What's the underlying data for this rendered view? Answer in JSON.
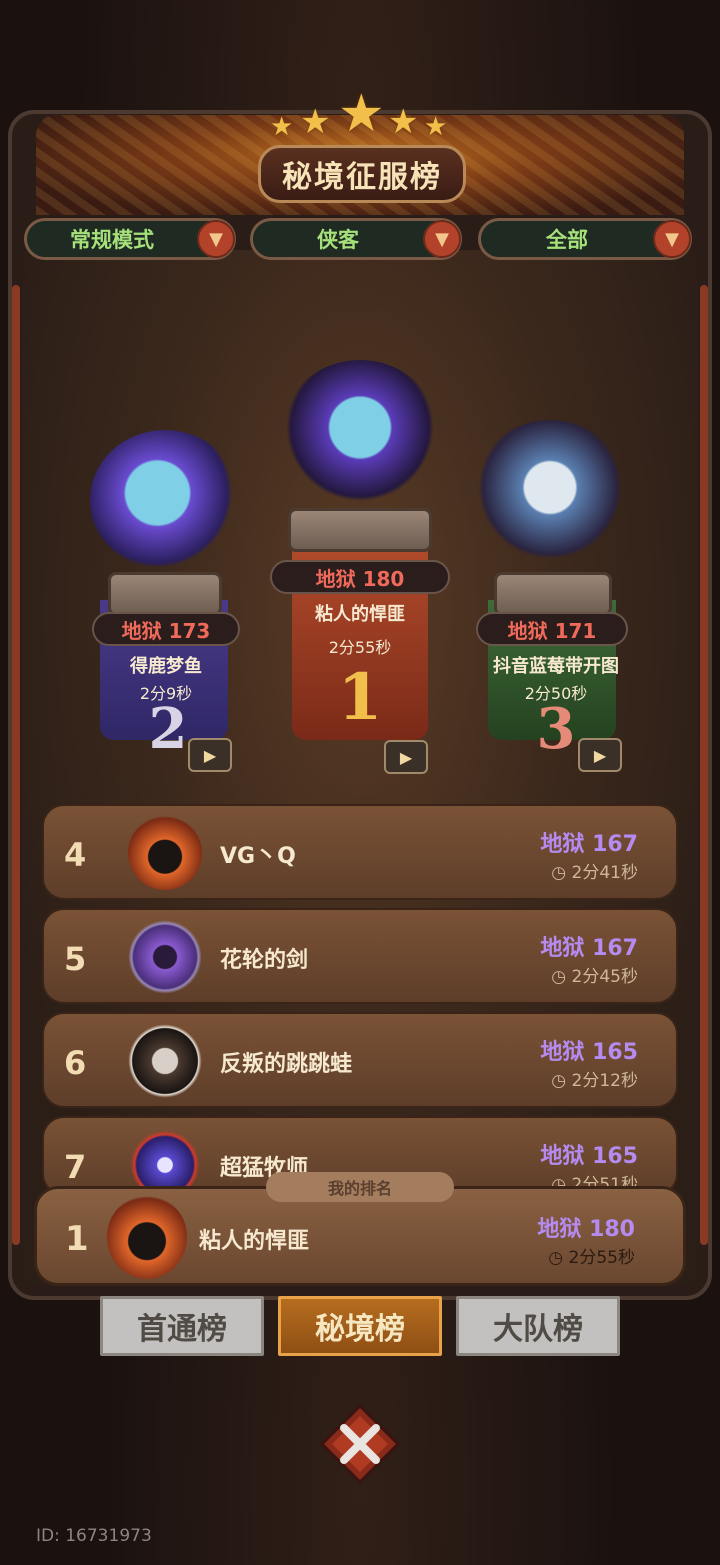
{
  "header": {
    "title": "秘境征服榜"
  },
  "filters": [
    {
      "label": "常规模式"
    },
    {
      "label": "侠客"
    },
    {
      "label": "全部"
    }
  ],
  "podium": {
    "second": {
      "level": "地狱 173",
      "name": "得鹿梦鱼",
      "time": "2分9秒",
      "rank": "2"
    },
    "first": {
      "level": "地狱 180",
      "name": "粘人的悍匪",
      "time": "2分55秒",
      "rank": "1"
    },
    "third": {
      "level": "地狱 171",
      "name": "抖音蓝莓带开图",
      "time": "2分50秒",
      "rank": "3"
    }
  },
  "list": [
    {
      "rank": "4",
      "name": "VG丶Q",
      "level": "地狱 167",
      "time": "2分41秒"
    },
    {
      "rank": "5",
      "name": "花轮的剑",
      "level": "地狱 167",
      "time": "2分45秒"
    },
    {
      "rank": "6",
      "name": "反叛的跳跳蛙",
      "level": "地狱 165",
      "time": "2分12秒"
    },
    {
      "rank": "7",
      "name": "超猛牧师",
      "level": "地狱 165",
      "time": "2分51秒"
    }
  ],
  "my_rank": {
    "tag": "我的排名",
    "rank": "1",
    "name": "粘人的悍匪",
    "level": "地狱 180",
    "time": "2分55秒"
  },
  "tabs": [
    {
      "label": "首通榜",
      "active": false
    },
    {
      "label": "秘境榜",
      "active": true
    },
    {
      "label": "大队榜",
      "active": false
    }
  ],
  "footer": {
    "id": "ID: 16731973"
  },
  "colors": {
    "accent_green": "#a6e07a",
    "hell_red": "#ef6a5a",
    "hell_purple": "#b58bf0",
    "tab_active": "#b66d1f"
  }
}
